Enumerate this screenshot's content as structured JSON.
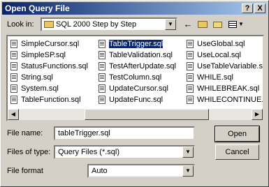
{
  "window": {
    "title": "Open Query File",
    "help_glyph": "?",
    "close_glyph": "X"
  },
  "lookin": {
    "label": "Look in:",
    "value": "SQL 2000 Step by Step"
  },
  "toolbar": {
    "back": "back-arrow-icon",
    "up": "up-folder-icon",
    "new_folder": "new-folder-icon",
    "view": "view-menu-icon"
  },
  "files": {
    "col1": [
      "SimpleCursor.sql",
      "SimpleSP.sql",
      "StatusFunctions.sql",
      "String.sql",
      "System.sql",
      "TableFunction.sql"
    ],
    "col2": [
      "TableTrigger.sql",
      "TableValidation.sql",
      "TestAfterUpdate.sql",
      "TestColumn.sql",
      "UpdateCursor.sql",
      "UpdateFunc.sql"
    ],
    "col3": [
      "UseGlobal.sql",
      "UseLocal.sql",
      "UseTableVariable.sql",
      "WHILE.sql",
      "WHILEBREAK.sql",
      "WHILECONTINUE.sql"
    ],
    "selected": "TableTrigger.sql"
  },
  "filename": {
    "label": "File name:",
    "value": "tableTrigger.sql"
  },
  "filetype": {
    "label": "Files of type:",
    "value": "Query Files (*.sql)"
  },
  "fileformat": {
    "label": "File format",
    "value": "Auto"
  },
  "buttons": {
    "open": "Open",
    "cancel": "Cancel"
  }
}
